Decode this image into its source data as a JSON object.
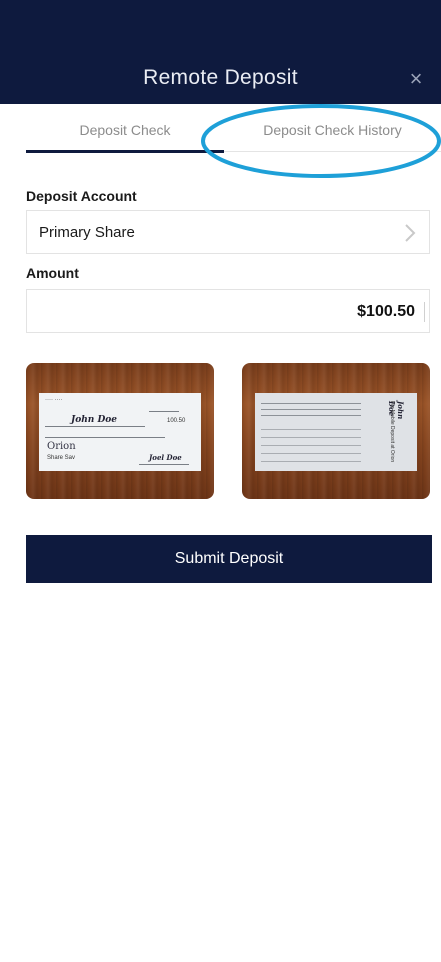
{
  "header": {
    "title": "Remote Deposit",
    "close_symbol": "×"
  },
  "tabs": [
    {
      "label": "Deposit Check",
      "active": true
    },
    {
      "label": "Deposit Check History",
      "active": false
    }
  ],
  "deposit_account": {
    "label": "Deposit Account",
    "value": "Primary Share"
  },
  "amount": {
    "label": "Amount",
    "value": "$100.50"
  },
  "check_front": {
    "payee_line": "John Doe",
    "bank_name": "Orion",
    "amount_box": "100.50",
    "memo": "Share Sav",
    "signature": "Joel Doe"
  },
  "check_back": {
    "endorsement": "John Doe",
    "note": "For Mobile Deposit at Orion"
  },
  "submit": {
    "label": "Submit Deposit"
  },
  "colors": {
    "navy": "#0e1a3e",
    "highlight": "#1ea0d8"
  }
}
